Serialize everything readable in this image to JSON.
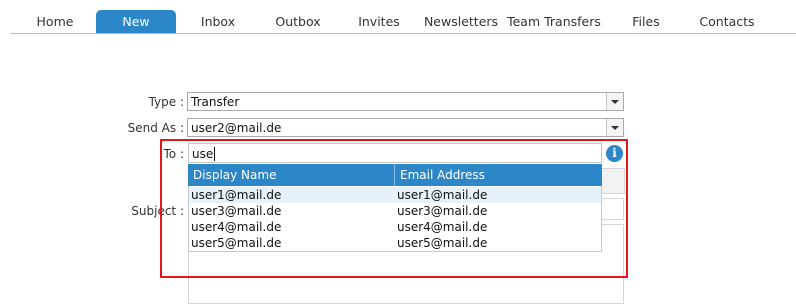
{
  "nav": {
    "tabs": [
      "Home",
      "New",
      "Inbox",
      "Outbox",
      "Invites",
      "Newsletters",
      "Team Transfers",
      "Files",
      "Contacts"
    ],
    "active": "New"
  },
  "form": {
    "type_label": "Type :",
    "type_value": "Transfer",
    "send_as_label": "Send As :",
    "send_as_value": "user2@mail.de",
    "to_label": "To :",
    "to_value": "use",
    "subject_label": "Subject :"
  },
  "autocomplete": {
    "columns": [
      "Display Name",
      "Email Address"
    ],
    "rows": [
      {
        "name": "user1@mail.de",
        "email": "user1@mail.de"
      },
      {
        "name": "user3@mail.de",
        "email": "user3@mail.de"
      },
      {
        "name": "user4@mail.de",
        "email": "user4@mail.de"
      },
      {
        "name": "user5@mail.de",
        "email": "user5@mail.de"
      }
    ],
    "selected_index": 0
  },
  "colors": {
    "accent": "#2b87c8",
    "highlight": "#e8161c"
  },
  "icons": {
    "info": "info-icon",
    "dropdown": "chevron-down-icon"
  }
}
